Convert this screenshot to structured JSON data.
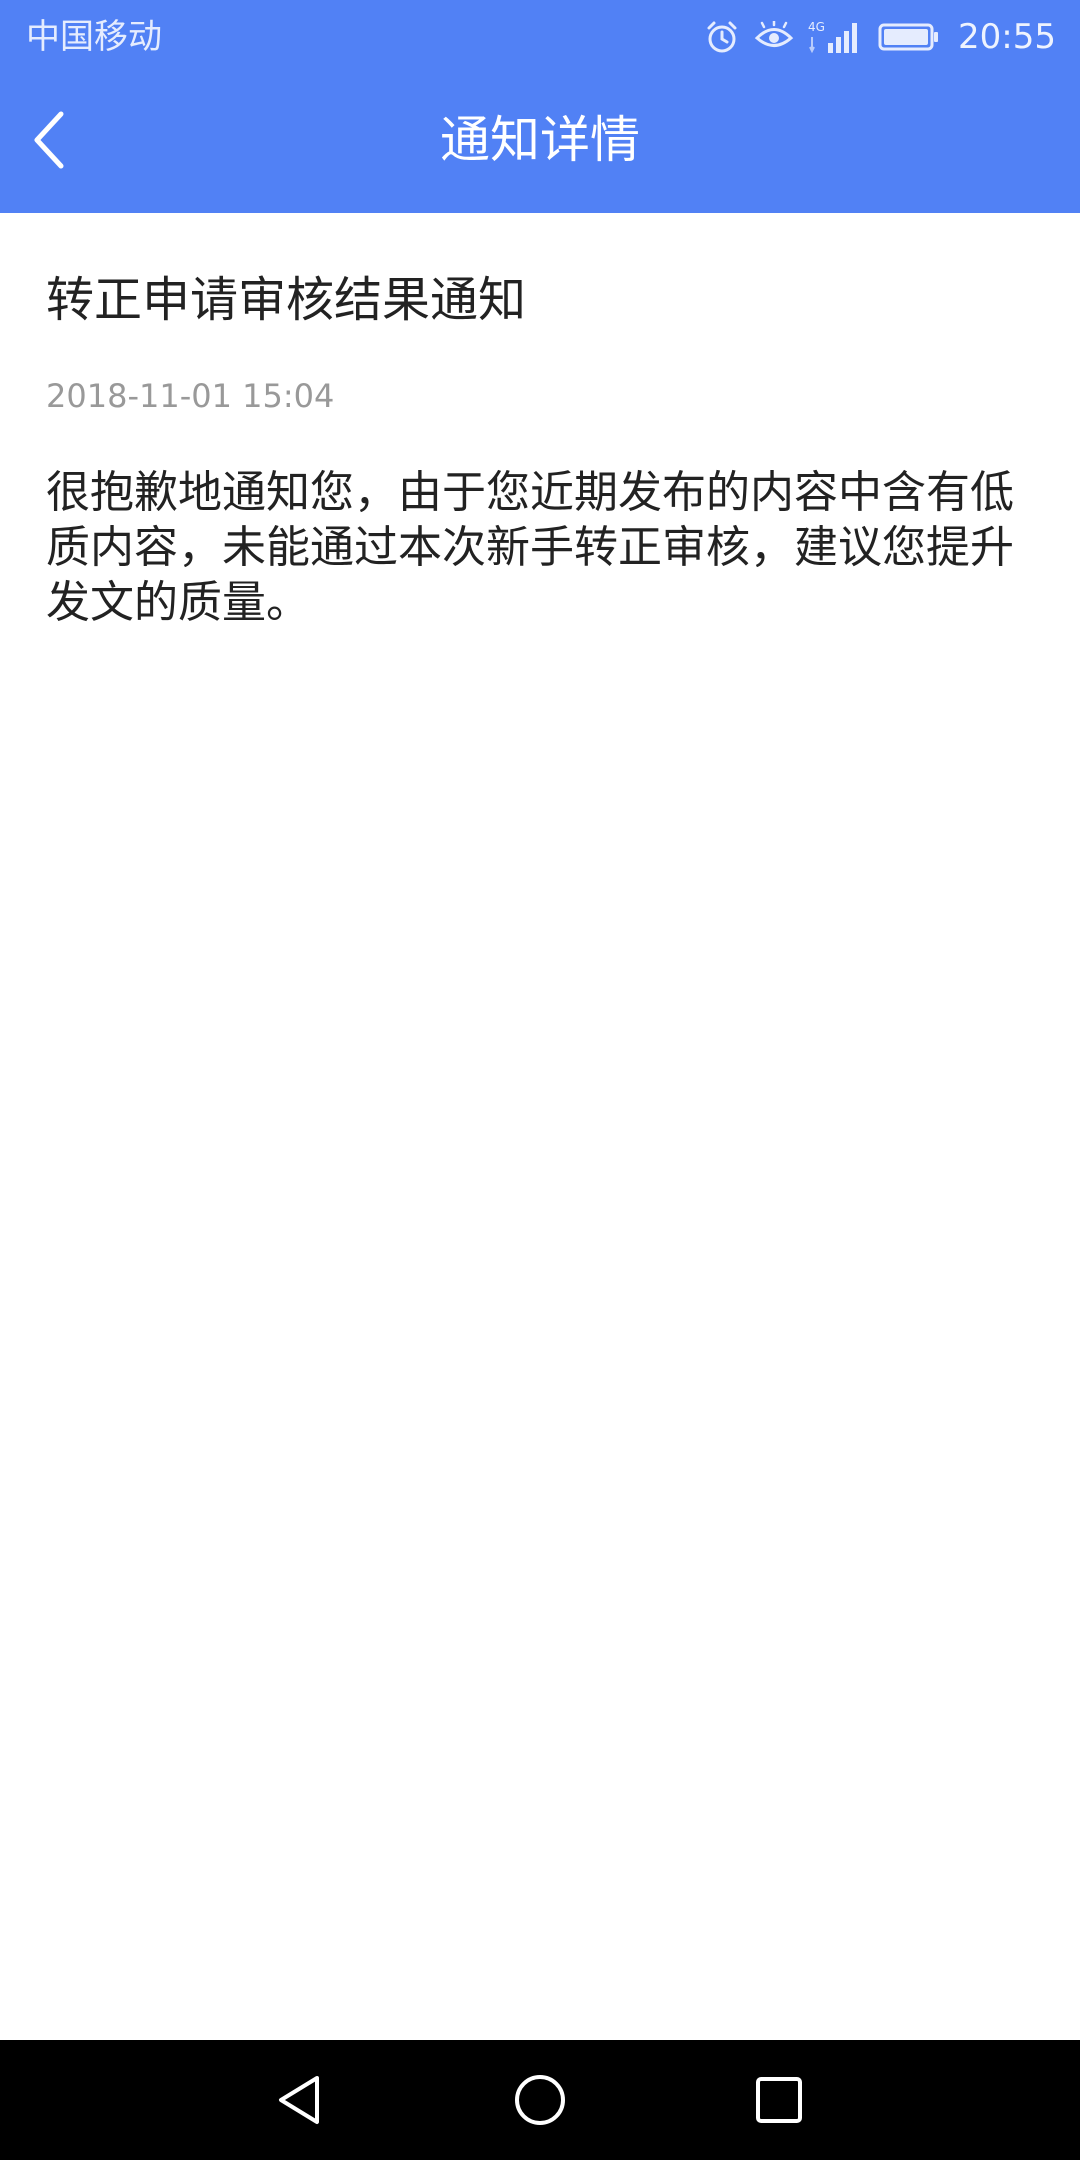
{
  "status_bar": {
    "carrier": "中国移动",
    "network": "4G",
    "time": "20:55",
    "icons": [
      "alarm-icon",
      "eye-comfort-icon",
      "signal-icon",
      "battery-icon"
    ]
  },
  "header": {
    "title": "通知详情",
    "back_icon": "chevron-left-icon",
    "background_color": "#5181F5"
  },
  "notice": {
    "title": "转正申请审核结果通知",
    "time": "2018-11-01 15:04",
    "body": "很抱歉地通知您，由于您近期发布的内容中含有低质内容，未能通过本次新手转正审核，建议您提升发文的质量。"
  },
  "nav_bar": {
    "buttons": [
      "back-triangle-icon",
      "home-circle-icon",
      "recents-square-icon"
    ]
  }
}
